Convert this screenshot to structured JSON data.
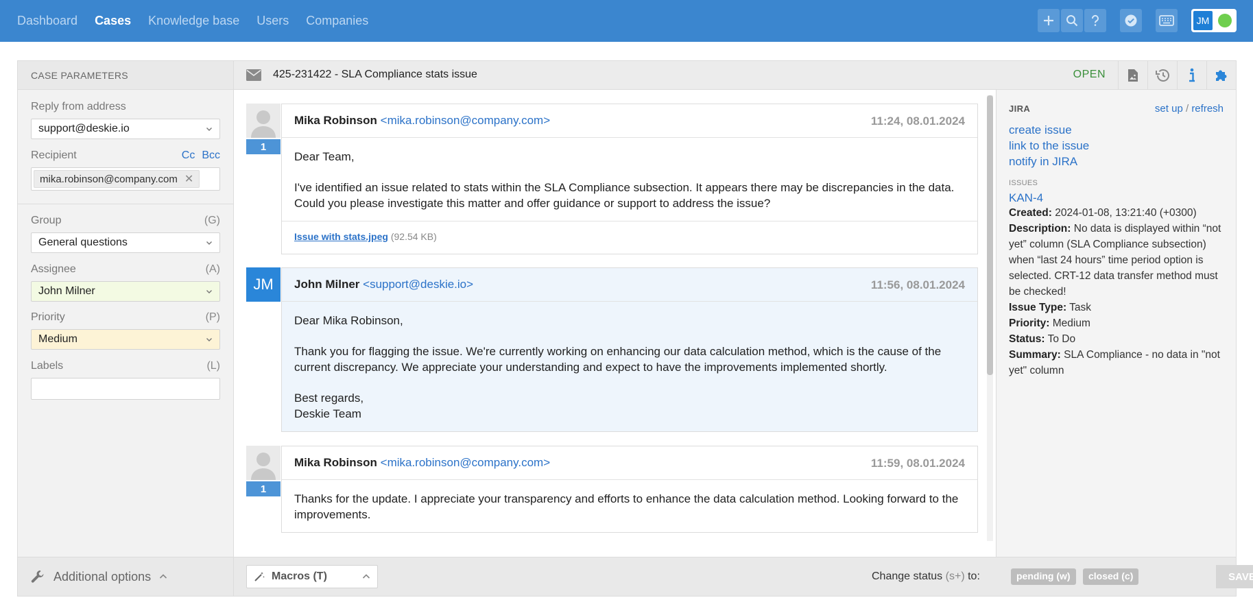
{
  "nav": {
    "items": [
      {
        "label": "Dashboard",
        "active": false
      },
      {
        "label": "Cases",
        "active": true
      },
      {
        "label": "Knowledge base",
        "active": false
      },
      {
        "label": "Users",
        "active": false
      },
      {
        "label": "Companies",
        "active": false
      }
    ],
    "user_initials": "JM"
  },
  "left": {
    "title": "CASE PARAMETERS",
    "reply_from_label": "Reply from address",
    "reply_from_value": "support@deskie.io",
    "recipient_label": "Recipient",
    "cc": "Cc",
    "bcc": "Bcc",
    "recipient_tag": "mika.robinson@company.com",
    "group_label": "Group",
    "group_key": "(G)",
    "group_value": "General questions",
    "assignee_label": "Assignee",
    "assignee_key": "(A)",
    "assignee_value": "John Milner",
    "priority_label": "Priority",
    "priority_key": "(P)",
    "priority_value": "Medium",
    "labels_label": "Labels",
    "labels_key": "(L)",
    "additional_options": "Additional options"
  },
  "case": {
    "title": "425-231422 - SLA Compliance stats issue",
    "status": "OPEN"
  },
  "messages": [
    {
      "name": "Mika Robinson",
      "email": "<mika.robinson@company.com>",
      "time": "11:24, 08.01.2024",
      "count": "1",
      "paragraphs": [
        "Dear Team,",
        "I've identified an issue related to stats within the SLA Compliance subsection. It appears there may be discrepancies in the data. Could you please investigate this matter and offer guidance or support to address the issue?"
      ],
      "attachment_name": "Issue with stats.jpeg",
      "attachment_size": "(92.54 KB)"
    },
    {
      "name": "John Milner",
      "email": "<support@deskie.io>",
      "time": "11:56, 08.01.2024",
      "initials": "JM",
      "paragraphs": [
        "Dear Mika Robinson,",
        "Thank you for flagging the issue. We're currently working on enhancing our data calculation method, which is the cause of the current discrepancy. We appreciate your understanding and expect to have the improvements implemented shortly.",
        "Best regards,",
        "Deskie Team"
      ]
    },
    {
      "name": "Mika Robinson",
      "email": "<mika.robinson@company.com>",
      "time": "11:59, 08.01.2024",
      "count": "1",
      "paragraphs": [
        "Thanks for the update. I appreciate your transparency and efforts to enhance the data calculation method. Looking forward to the improvements."
      ]
    }
  ],
  "footer": {
    "macros": "Macros (T)",
    "change_status": "Change status",
    "change_status_key": "(s+)",
    "change_status_to": "to:",
    "pending": "pending (w)",
    "closed": "closed (c)",
    "save": "SAVE"
  },
  "jira": {
    "title": "JIRA",
    "set_up": "set up",
    "slash": "/",
    "refresh": "refresh",
    "links": [
      "create issue",
      "link to the issue",
      "notify in JIRA"
    ],
    "issues_label": "ISSUES",
    "issue_key": "KAN-4",
    "fields": [
      {
        "k": "Created:",
        "v": "2024-01-08, 13:21:40 (+0300)"
      },
      {
        "k": "Description:",
        "v": "No data is displayed within “not yet” column (SLA Compliance subsection) when “last 24 hours” time period option is selected. CRT-12 data transfer method must be checked!"
      },
      {
        "k": "Issue Type:",
        "v": "Task"
      },
      {
        "k": "Priority:",
        "v": "Medium"
      },
      {
        "k": "Status:",
        "v": "To Do"
      },
      {
        "k": "Summary:",
        "v": "SLA Compliance - no data in \"not yet\" column"
      }
    ]
  },
  "colors": {
    "topbar": "#3b86cf",
    "accent_link": "#2b72c8",
    "open_status": "#3a8f3a",
    "assignee_bg": "#f3fae3",
    "priority_bg": "#fdf3d6"
  }
}
